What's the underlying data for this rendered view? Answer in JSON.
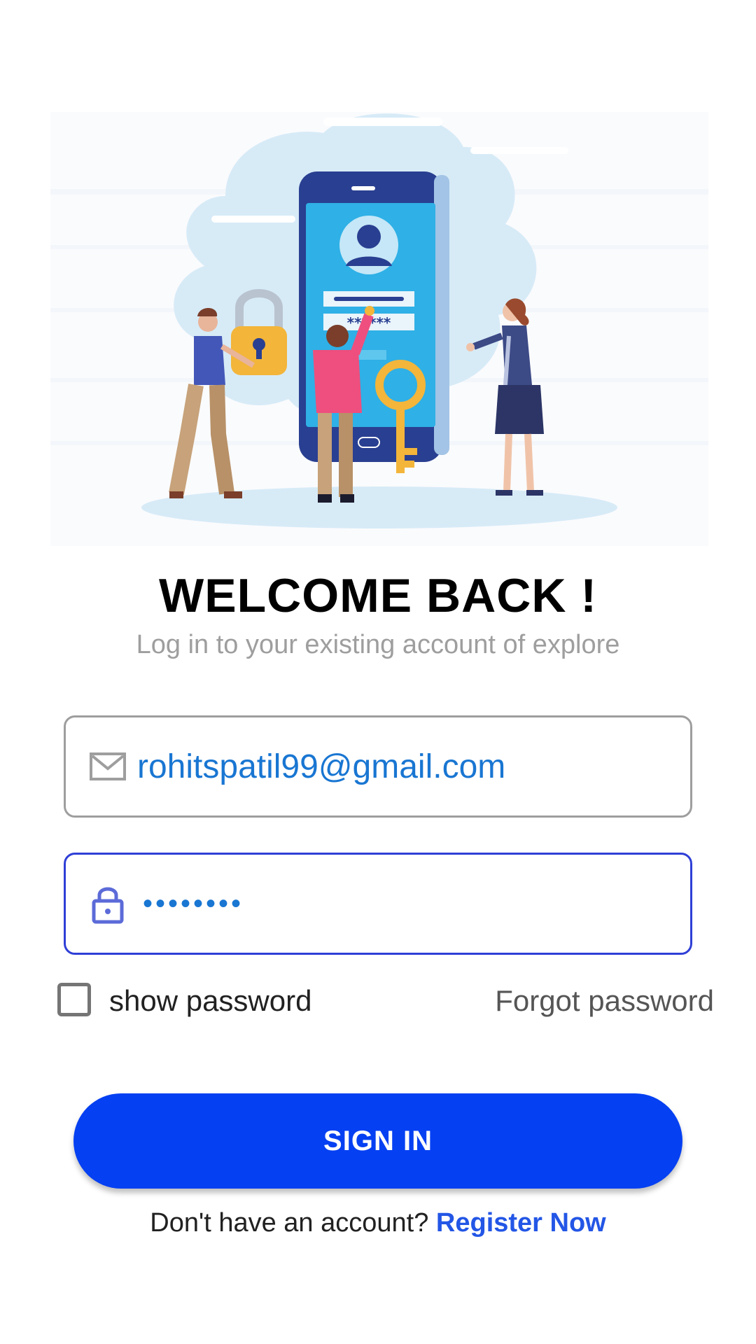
{
  "header": {
    "title": "WELCOME BACK !",
    "subtitle": "Log in to your existing account of explore"
  },
  "hero": {
    "password_mask": "******"
  },
  "form": {
    "email": {
      "value": "rohitspatil99@gmail.com",
      "icon": "mail-icon"
    },
    "password": {
      "value": "••••••••",
      "icon": "lock-icon"
    },
    "show_password_label": "show password",
    "forgot_password_label": "Forgot password",
    "sign_in_label": "SIGN IN"
  },
  "footer": {
    "prompt": "Don't have an account?",
    "register_label": "Register Now"
  },
  "colors": {
    "primary": "#0540f2",
    "link": "#2356e6",
    "input_text": "#1976d2",
    "focused_border": "#2f3fd6"
  }
}
